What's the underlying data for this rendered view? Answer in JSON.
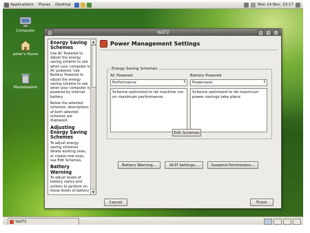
{
  "panel": {
    "menus": [
      "Applications",
      "Places",
      "Desktop"
    ],
    "clock": "Mon 14 Nov, 23:17"
  },
  "desktop": {
    "icons": [
      {
        "label": "Computer"
      },
      {
        "label": "peter's Home"
      },
      {
        "label": "Wastebasket"
      }
    ]
  },
  "window": {
    "title": "YaST2",
    "header": "Power Management Settings",
    "help": {
      "sections": [
        {
          "title": "Energy Saving Schemes",
          "body": "Use AC Powered to adjust the energy saving scheme to use when your computer is AC powered. Use Battery Powered to adjust the energy saving scheme to use when your computer is powered by internal battery."
        },
        {
          "title": "",
          "body": "Below the selected schemes, descriptions of both selected schemes are displayed."
        },
        {
          "title": "Adjusting Energy Saving Schemes",
          "body": "To adjust energy saving schemes, delete existing ones, or create new ones, use Edit Schemes."
        },
        {
          "title": "Battery Warning",
          "body": "To adjust levels of battery status and actions to perform on these levels of battery"
        }
      ]
    },
    "schemes": {
      "group_label": "Energy Saving Schemes",
      "ac_label": "AC Powered",
      "ac_value": "Performance",
      "ac_desc": "Scheme optimized to let machine run on maximum performance.",
      "battery_label": "Battery Powered",
      "battery_value": "Powersave",
      "battery_desc": "Scheme optimized to let maximum power savings take place.",
      "edit_button": "Edit Schemes"
    },
    "buttons": {
      "battery_warning": "Battery Warning...",
      "acpi": "ACPI Settings...",
      "suspend": "Suspend Permissions...",
      "cancel": "Cancel",
      "finish": "Finish"
    }
  },
  "taskbar": {
    "task_label": "YaST2"
  },
  "colors": {
    "desktop_green": "#3f7f24",
    "window_bg": "#ecebe6",
    "titlebar": "#55544f"
  }
}
